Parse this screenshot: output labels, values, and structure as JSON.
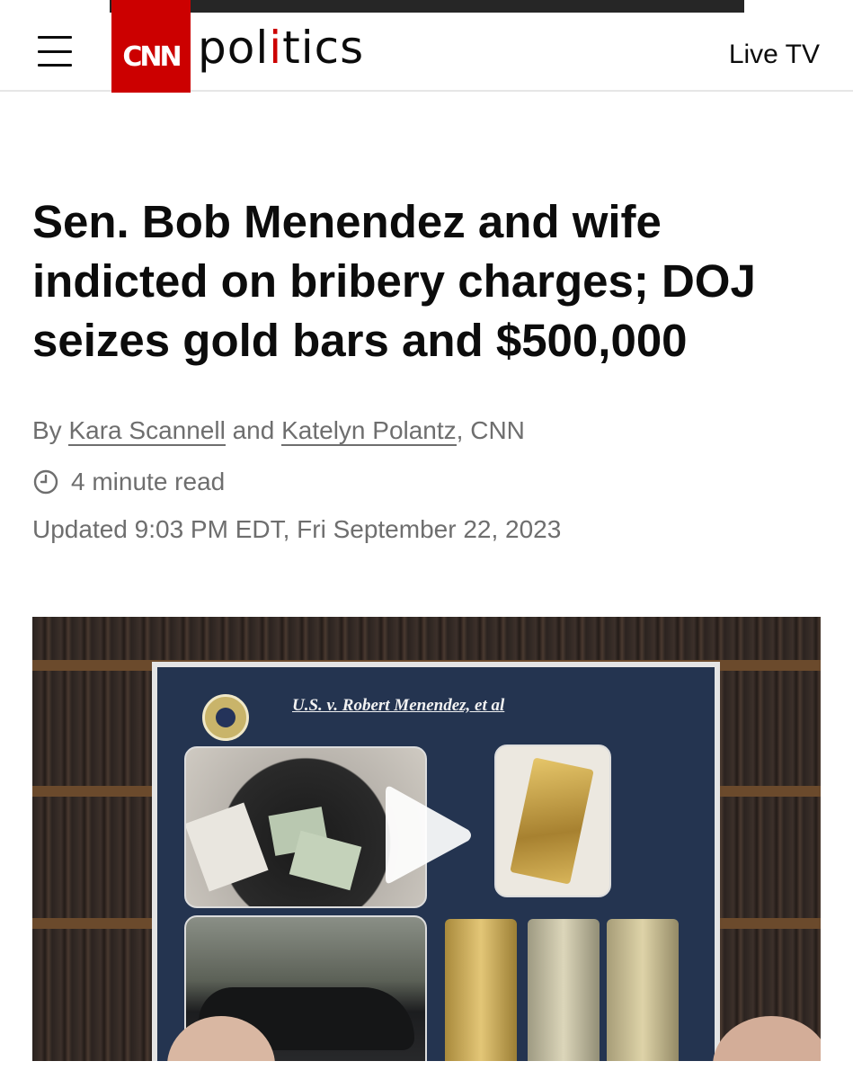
{
  "header": {
    "logo_text": "CNN",
    "section_prefix": "pol",
    "section_i": "i",
    "section_suffix": "tics",
    "live_tv_label": "Live TV",
    "brand_color": "#cc0000"
  },
  "article": {
    "headline": "Sen. Bob Menendez and wife indicted on bribery charges; DOJ seizes gold bars and $500,000",
    "byline": {
      "prefix": "By",
      "author_1": "Kara Scannell",
      "joiner": "and",
      "author_2": "Katelyn Polantz",
      "suffix": ", CNN"
    },
    "read_time": "4 minute read",
    "updated": "Updated 9:03 PM EDT, Fri September 22, 2023"
  },
  "video": {
    "board_title": "U.S. v. Robert Menendez, et al",
    "play_icon": "play-icon"
  }
}
